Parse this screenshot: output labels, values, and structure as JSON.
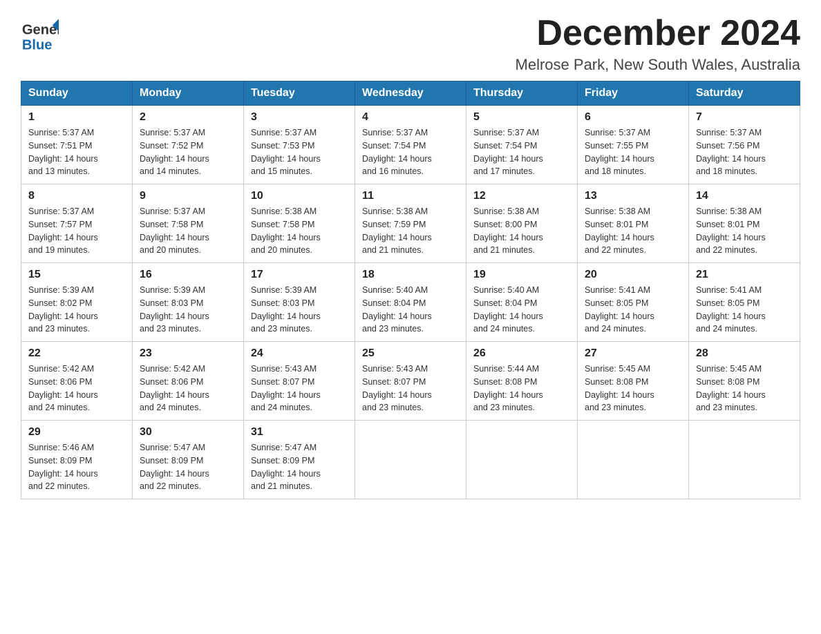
{
  "header": {
    "logo_general": "General",
    "logo_blue": "Blue",
    "month_title": "December 2024",
    "location": "Melrose Park, New South Wales, Australia"
  },
  "weekdays": [
    "Sunday",
    "Monday",
    "Tuesday",
    "Wednesday",
    "Thursday",
    "Friday",
    "Saturday"
  ],
  "weeks": [
    [
      {
        "day": "1",
        "sunrise": "5:37 AM",
        "sunset": "7:51 PM",
        "daylight": "14 hours and 13 minutes."
      },
      {
        "day": "2",
        "sunrise": "5:37 AM",
        "sunset": "7:52 PM",
        "daylight": "14 hours and 14 minutes."
      },
      {
        "day": "3",
        "sunrise": "5:37 AM",
        "sunset": "7:53 PM",
        "daylight": "14 hours and 15 minutes."
      },
      {
        "day": "4",
        "sunrise": "5:37 AM",
        "sunset": "7:54 PM",
        "daylight": "14 hours and 16 minutes."
      },
      {
        "day": "5",
        "sunrise": "5:37 AM",
        "sunset": "7:54 PM",
        "daylight": "14 hours and 17 minutes."
      },
      {
        "day": "6",
        "sunrise": "5:37 AM",
        "sunset": "7:55 PM",
        "daylight": "14 hours and 18 minutes."
      },
      {
        "day": "7",
        "sunrise": "5:37 AM",
        "sunset": "7:56 PM",
        "daylight": "14 hours and 18 minutes."
      }
    ],
    [
      {
        "day": "8",
        "sunrise": "5:37 AM",
        "sunset": "7:57 PM",
        "daylight": "14 hours and 19 minutes."
      },
      {
        "day": "9",
        "sunrise": "5:37 AM",
        "sunset": "7:58 PM",
        "daylight": "14 hours and 20 minutes."
      },
      {
        "day": "10",
        "sunrise": "5:38 AM",
        "sunset": "7:58 PM",
        "daylight": "14 hours and 20 minutes."
      },
      {
        "day": "11",
        "sunrise": "5:38 AM",
        "sunset": "7:59 PM",
        "daylight": "14 hours and 21 minutes."
      },
      {
        "day": "12",
        "sunrise": "5:38 AM",
        "sunset": "8:00 PM",
        "daylight": "14 hours and 21 minutes."
      },
      {
        "day": "13",
        "sunrise": "5:38 AM",
        "sunset": "8:01 PM",
        "daylight": "14 hours and 22 minutes."
      },
      {
        "day": "14",
        "sunrise": "5:38 AM",
        "sunset": "8:01 PM",
        "daylight": "14 hours and 22 minutes."
      }
    ],
    [
      {
        "day": "15",
        "sunrise": "5:39 AM",
        "sunset": "8:02 PM",
        "daylight": "14 hours and 23 minutes."
      },
      {
        "day": "16",
        "sunrise": "5:39 AM",
        "sunset": "8:03 PM",
        "daylight": "14 hours and 23 minutes."
      },
      {
        "day": "17",
        "sunrise": "5:39 AM",
        "sunset": "8:03 PM",
        "daylight": "14 hours and 23 minutes."
      },
      {
        "day": "18",
        "sunrise": "5:40 AM",
        "sunset": "8:04 PM",
        "daylight": "14 hours and 23 minutes."
      },
      {
        "day": "19",
        "sunrise": "5:40 AM",
        "sunset": "8:04 PM",
        "daylight": "14 hours and 24 minutes."
      },
      {
        "day": "20",
        "sunrise": "5:41 AM",
        "sunset": "8:05 PM",
        "daylight": "14 hours and 24 minutes."
      },
      {
        "day": "21",
        "sunrise": "5:41 AM",
        "sunset": "8:05 PM",
        "daylight": "14 hours and 24 minutes."
      }
    ],
    [
      {
        "day": "22",
        "sunrise": "5:42 AM",
        "sunset": "8:06 PM",
        "daylight": "14 hours and 24 minutes."
      },
      {
        "day": "23",
        "sunrise": "5:42 AM",
        "sunset": "8:06 PM",
        "daylight": "14 hours and 24 minutes."
      },
      {
        "day": "24",
        "sunrise": "5:43 AM",
        "sunset": "8:07 PM",
        "daylight": "14 hours and 24 minutes."
      },
      {
        "day": "25",
        "sunrise": "5:43 AM",
        "sunset": "8:07 PM",
        "daylight": "14 hours and 23 minutes."
      },
      {
        "day": "26",
        "sunrise": "5:44 AM",
        "sunset": "8:08 PM",
        "daylight": "14 hours and 23 minutes."
      },
      {
        "day": "27",
        "sunrise": "5:45 AM",
        "sunset": "8:08 PM",
        "daylight": "14 hours and 23 minutes."
      },
      {
        "day": "28",
        "sunrise": "5:45 AM",
        "sunset": "8:08 PM",
        "daylight": "14 hours and 23 minutes."
      }
    ],
    [
      {
        "day": "29",
        "sunrise": "5:46 AM",
        "sunset": "8:09 PM",
        "daylight": "14 hours and 22 minutes."
      },
      {
        "day": "30",
        "sunrise": "5:47 AM",
        "sunset": "8:09 PM",
        "daylight": "14 hours and 22 minutes."
      },
      {
        "day": "31",
        "sunrise": "5:47 AM",
        "sunset": "8:09 PM",
        "daylight": "14 hours and 21 minutes."
      },
      null,
      null,
      null,
      null
    ]
  ],
  "labels": {
    "sunrise": "Sunrise:",
    "sunset": "Sunset:",
    "daylight": "Daylight:"
  }
}
